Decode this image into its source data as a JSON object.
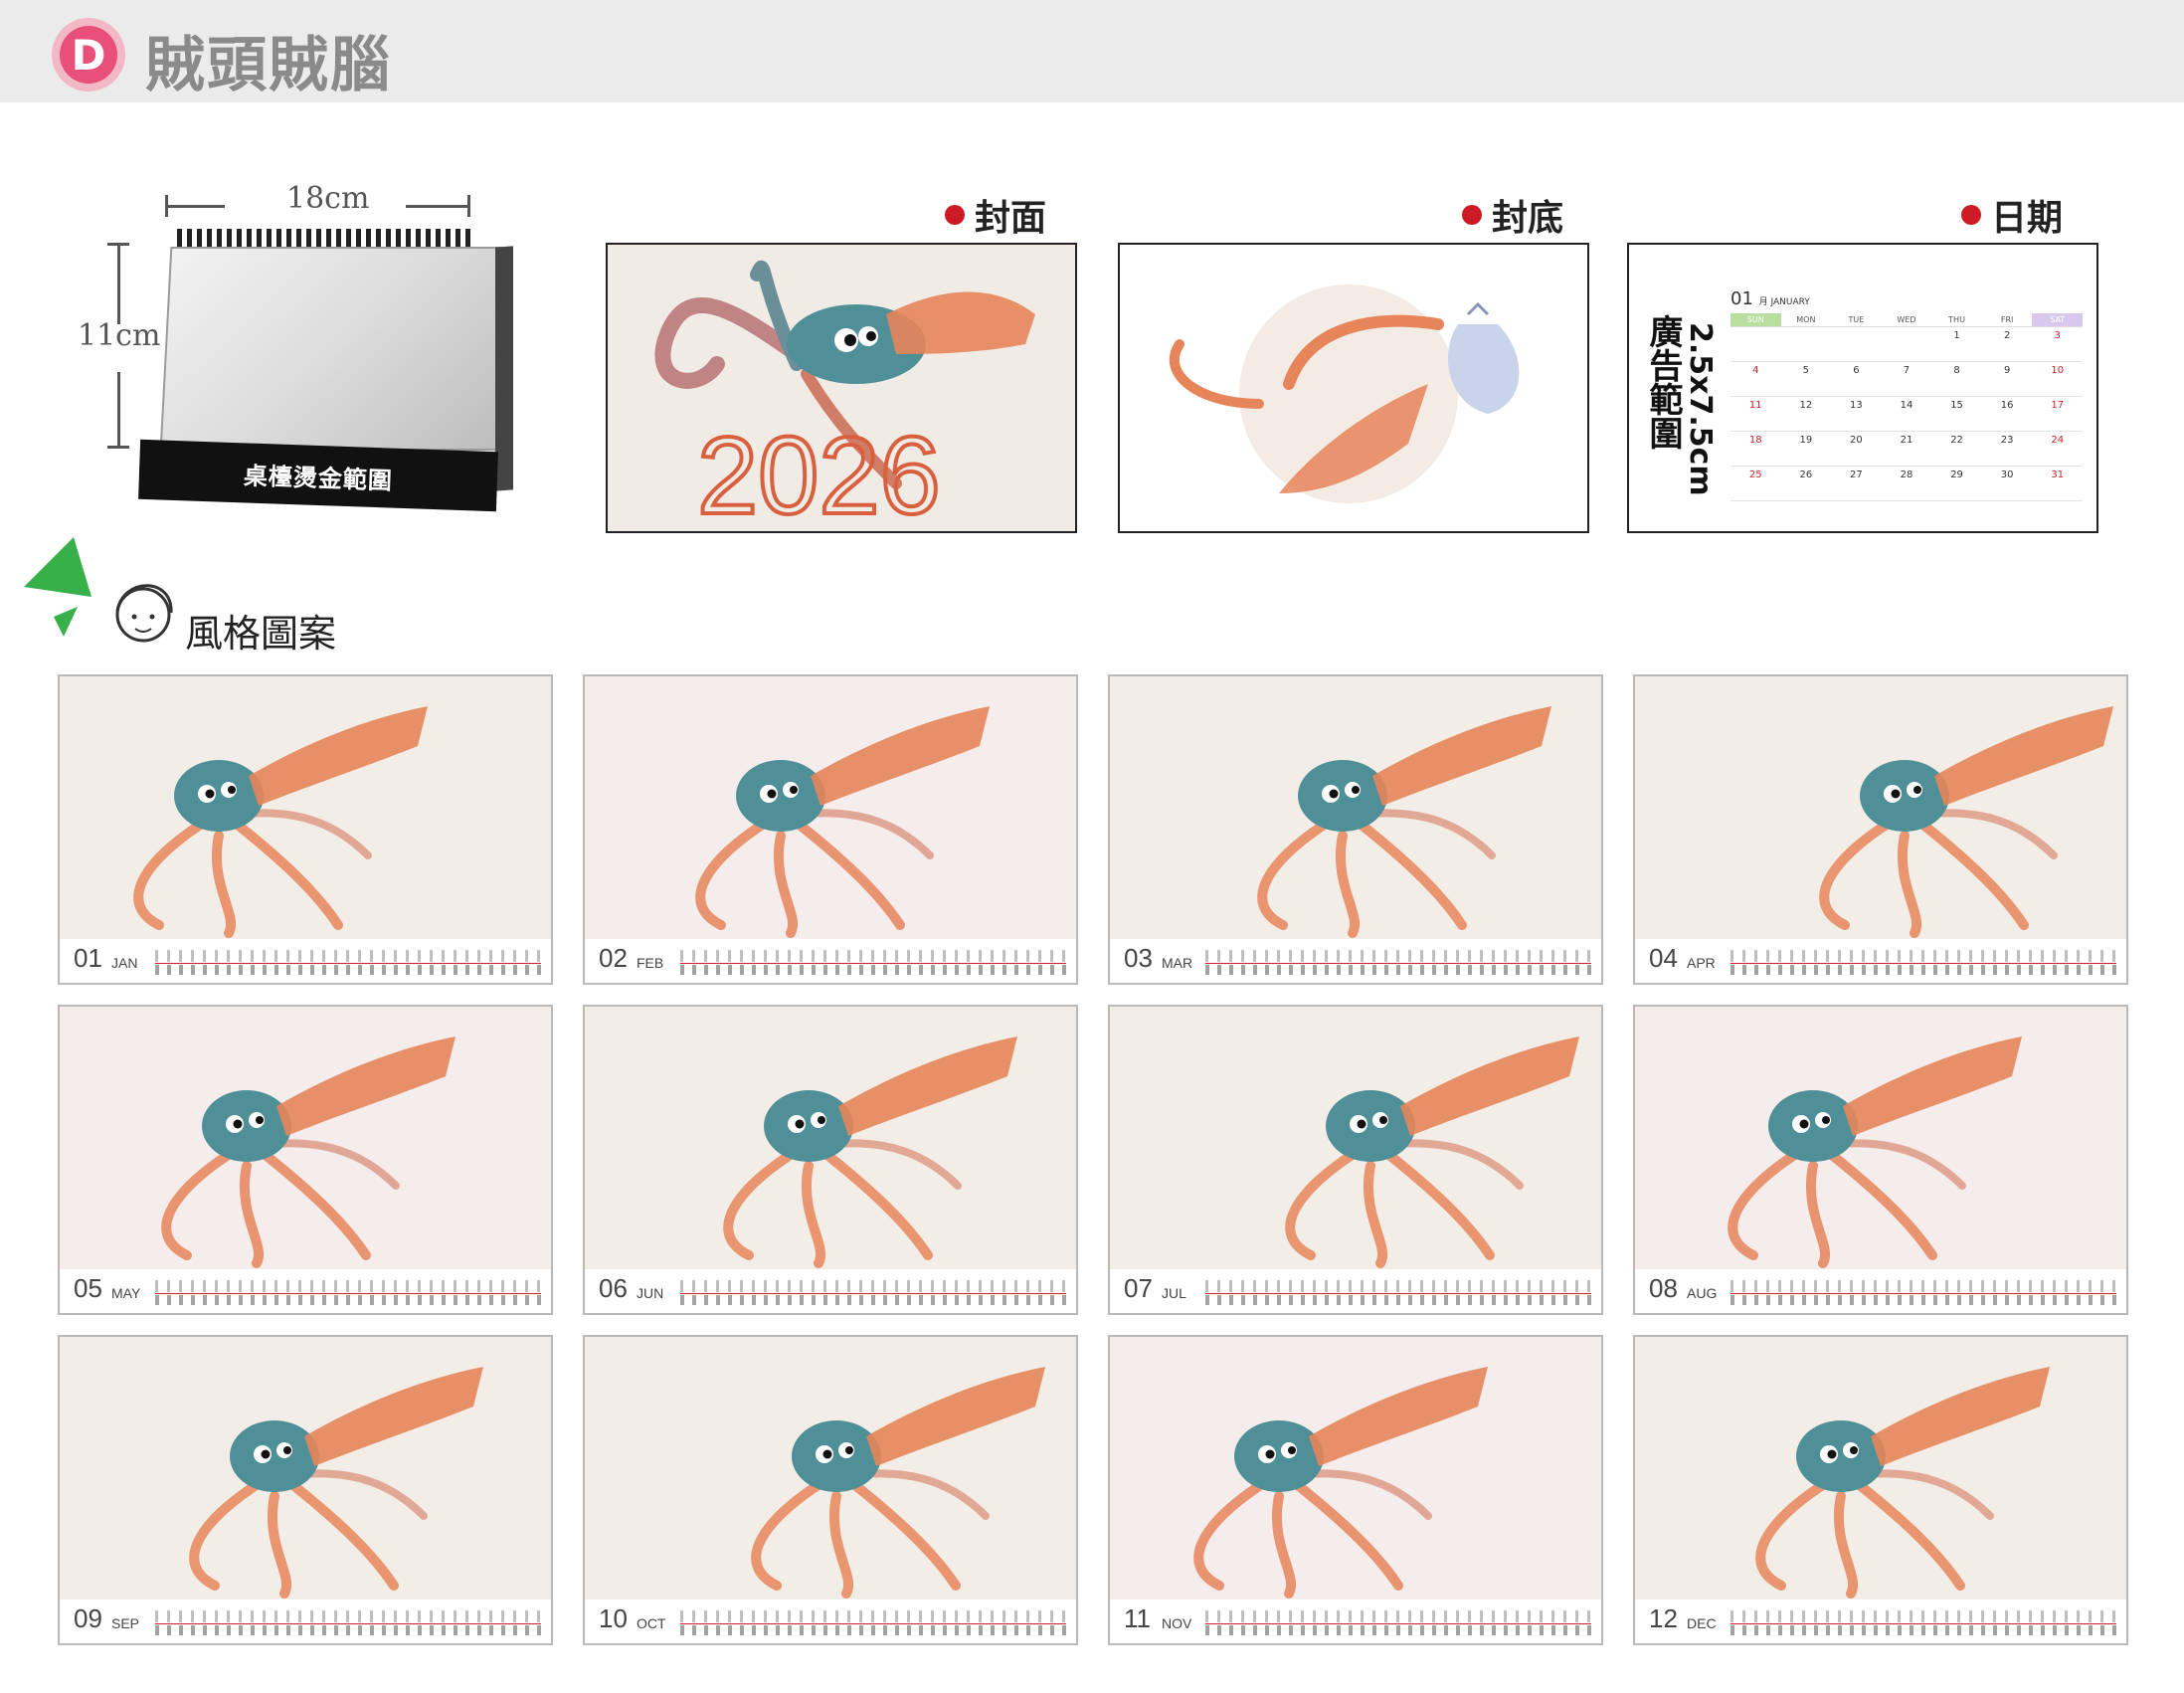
{
  "header": {
    "badge": "D",
    "title": "賊頭賊腦"
  },
  "desk": {
    "width_label": "18cm",
    "height_label": "11cm",
    "base_label": "桌檯燙金範圍"
  },
  "previews": {
    "cover_label": "封面",
    "back_label": "封底",
    "date_label": "日期",
    "cover_year": "2026",
    "date": {
      "ad_text": "廣告範圍",
      "ad_size": "2.5x7.5cm",
      "month_num": "01",
      "month_name": "月 JANUARY",
      "weekdays": [
        "SUN",
        "MON",
        "TUE",
        "WED",
        "THU",
        "FRI",
        "SAT"
      ],
      "days": [
        "",
        "",
        "",
        "",
        "1",
        "2",
        "3",
        "4",
        "5",
        "6",
        "7",
        "8",
        "9",
        "10",
        "11",
        "12",
        "13",
        "14",
        "15",
        "16",
        "17",
        "18",
        "19",
        "20",
        "21",
        "22",
        "23",
        "24",
        "25",
        "26",
        "27",
        "28",
        "29",
        "30",
        "31"
      ]
    }
  },
  "style_section": {
    "label": "風格圖案"
  },
  "months": [
    {
      "num": "01",
      "name": "JAN"
    },
    {
      "num": "02",
      "name": "FEB"
    },
    {
      "num": "03",
      "name": "MAR"
    },
    {
      "num": "04",
      "name": "APR"
    },
    {
      "num": "05",
      "name": "MAY"
    },
    {
      "num": "06",
      "name": "JUN"
    },
    {
      "num": "07",
      "name": "JUL"
    },
    {
      "num": "08",
      "name": "AUG"
    },
    {
      "num": "09",
      "name": "SEP"
    },
    {
      "num": "10",
      "name": "OCT"
    },
    {
      "num": "11",
      "name": "NOV"
    },
    {
      "num": "12",
      "name": "DEC"
    }
  ],
  "colors": {
    "accent_red": "#cc1b24",
    "badge_pink": "#e8507a",
    "squid_teal": "#4f8f97",
    "squid_orange": "#e6855a"
  }
}
